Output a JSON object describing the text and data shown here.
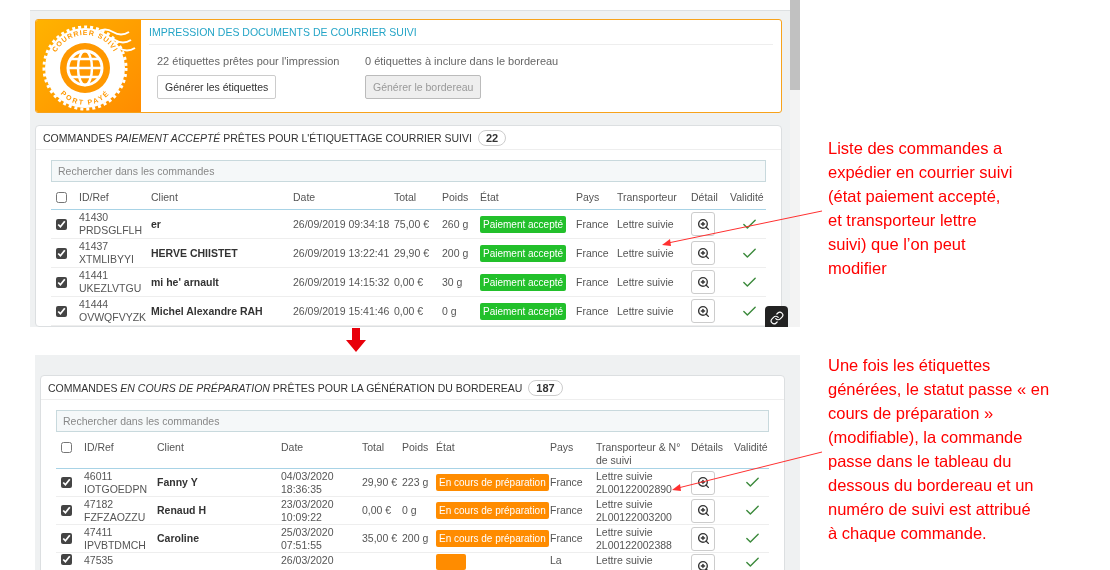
{
  "print_panel": {
    "logo_top": "COURRIER SUIVI",
    "logo_bottom": "PORT PAYÉ",
    "title": "IMPRESSION DES DOCUMENTS DE COURRIER SUIVI",
    "labels_ready": "22 étiquettes prêtes pour l'impression",
    "generate_labels": {
      "label": "Générer les étiquettes",
      "disabled": false
    },
    "manifest_count": "0 étiquettes à inclure dans le bordereau",
    "generate_manifest": {
      "label": "Générer le bordereau",
      "disabled": true
    }
  },
  "tables": [
    {
      "title": "COMMANDES *PAIEMENT ACCEPTÉ* PRÊTES POUR L'ÉTIQUETTAGE COURRIER SUIVI",
      "count": "22",
      "search_placeholder": "Rechercher dans les commandes",
      "select_all_checked": false,
      "columns": [
        "ID/Ref",
        "Client",
        "Date",
        "Total",
        "Poids",
        "État",
        "Pays",
        "Transporteur",
        "Détail",
        "Validité"
      ],
      "rows": [
        {
          "checked": true,
          "id": "41430",
          "ref": "PRDSGLFLH",
          "client": "er",
          "date": "26/09/2019 09:34:18",
          "total": "75,00 €",
          "weight": "260 g",
          "status": "Paiement accepté",
          "color": "#22c02b",
          "country": "France",
          "carrier": "Lettre suivie",
          "valid": true
        },
        {
          "checked": true,
          "id": "41437",
          "ref": "XTMLIBYYI",
          "client": "HERVE CHIISTET",
          "date": "26/09/2019 13:22:41",
          "total": "29,90 €",
          "weight": "200 g",
          "status": "Paiement accepté",
          "color": "#22c02b",
          "country": "France",
          "carrier": "Lettre suivie",
          "valid": true
        },
        {
          "checked": true,
          "id": "41441",
          "ref": "UKEZLVTGU",
          "client": "mi he' arnault",
          "date": "26/09/2019 14:15:32",
          "total": "0,00 €",
          "weight": "30 g",
          "status": "Paiement accepté",
          "color": "#22c02b",
          "country": "France",
          "carrier": "Lettre suivie",
          "valid": true
        },
        {
          "checked": true,
          "id": "41444",
          "ref": "OVWQFVYZK",
          "client": "Michel Alexandre RAH",
          "date": "26/09/2019 15:41:46",
          "total": "0,00 €",
          "weight": "0 g",
          "status": "Paiement accepté",
          "color": "#22c02b",
          "country": "France",
          "carrier": "Lettre suivie",
          "valid": true
        }
      ]
    },
    {
      "title": "COMMANDES *EN COURS DE PRÉPARATION* PRÊTES POUR LA GÉNÉRATION DU BORDEREAU",
      "count": "187",
      "search_placeholder": "Rechercher dans les commandes",
      "select_all_checked": false,
      "columns": [
        "ID/Ref",
        "Client",
        "Date",
        "Total",
        "Poids",
        "État",
        "Pays",
        "Transporteur & N° de suivi",
        "Détails",
        "Validité"
      ],
      "rows": [
        {
          "checked": true,
          "id": "46011",
          "ref": "IOTGOEDPN",
          "client": "Fanny Y",
          "date": "04/03/2020 18:36:35",
          "total": "29,90 €",
          "weight": "223 g",
          "status": "En cours de préparation",
          "color": "#ff8c00",
          "country": "France",
          "carrier": "Lettre suivie",
          "tracking": "2L00122002890",
          "valid": true
        },
        {
          "checked": true,
          "id": "47182",
          "ref": "FZFZAOZZU",
          "client": "Renaud H",
          "date": "23/03/2020 10:09:22",
          "total": "0,00 €",
          "weight": "0 g",
          "status": "En cours de préparation",
          "color": "#ff8c00",
          "country": "France",
          "carrier": "Lettre suivie",
          "tracking": "2L00122003200",
          "valid": true
        },
        {
          "checked": true,
          "id": "47411",
          "ref": "IPVBTDMCH",
          "client": "Caroline",
          "date": "25/03/2020 07:51:55",
          "total": "35,00 €",
          "weight": "200 g",
          "status": "En cours de préparation",
          "color": "#ff8c00",
          "country": "France",
          "carrier": "Lettre suivie",
          "tracking": "2L00122002388",
          "valid": true
        },
        {
          "checked": true,
          "id": "47535",
          "date": "26/03/2020",
          "color": "#ff8c00",
          "country": "La",
          "carrier": "Lettre suivie",
          "valid": true
        }
      ]
    }
  ],
  "annotations": [
    "Liste des commandes a\nexpédier en courrier suivi\n(état paiement accepté,\net transporteur lettre\nsuivi) que l’on peut\nmodifier",
    "Une fois les étiquettes\ngénérées, le statut passe « en\ncours de préparation »\n(modifiable), la commande\npasse dans le tableau du\ndessous du bordereau et un\nnuméro de suivi est attribué\nà chaque commande."
  ]
}
